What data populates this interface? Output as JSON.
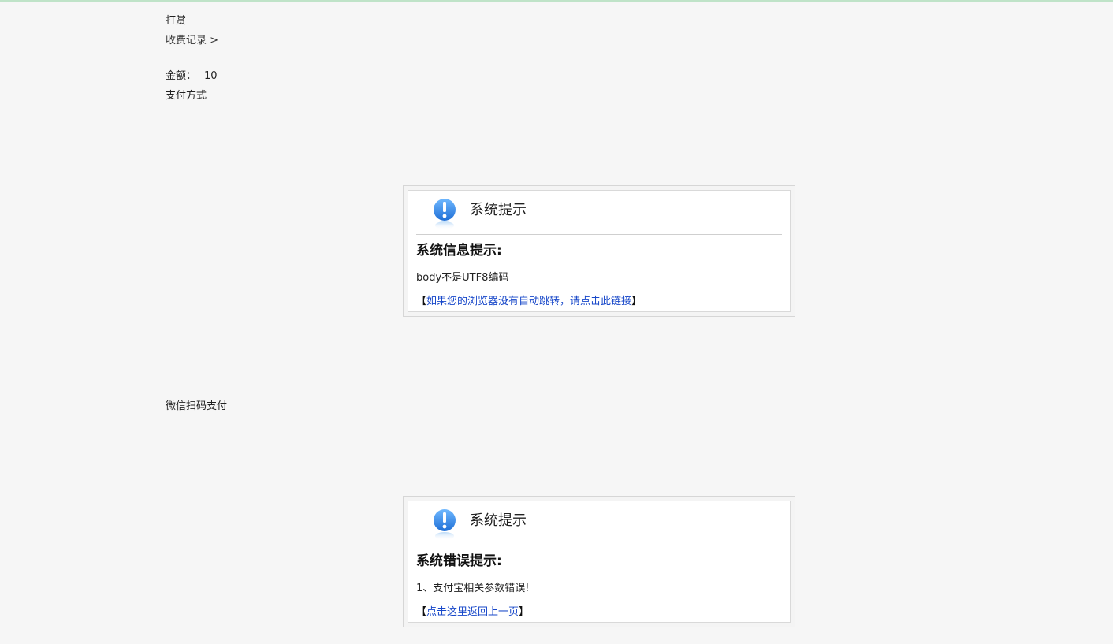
{
  "header": {
    "reward_label": "打赏",
    "records_link": "收费记录 >"
  },
  "payment": {
    "amount_label": "金额：",
    "amount_value": "10",
    "method_label": "支付方式",
    "wechat_label": "微信扫码支付"
  },
  "dialogs": [
    {
      "title": "系统提示",
      "subtitle": "系统信息提示:",
      "message": "body不是UTF8编码",
      "link_open": "【",
      "link_text": "如果您的浏览器没有自动跳转，请点击此链接",
      "link_close": "】"
    },
    {
      "title": "系统提示",
      "subtitle": "系统错误提示:",
      "message": "1、支付宝相关参数错误!",
      "link_open": "【",
      "link_text": "点击这里返回上一页",
      "link_close": "】"
    }
  ],
  "icons": {
    "dialog_icon": "exclamation-icon"
  },
  "colors": {
    "top_line": "#bfe3c8",
    "link": "#1747c9",
    "icon_blue": "#2f8fe8"
  }
}
